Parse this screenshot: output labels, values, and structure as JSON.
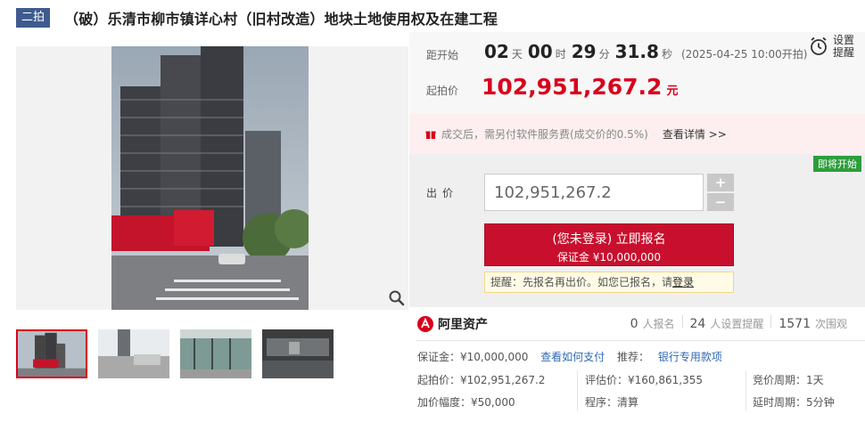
{
  "header": {
    "round_tag": "二拍",
    "title": "（破）乐清市柳市镇详心村（旧村改造）地块土地使用权及在建工程"
  },
  "countdown": {
    "label": "距开始",
    "days": "02",
    "days_unit": "天",
    "hours": "00",
    "hours_unit": "时",
    "minutes": "29",
    "minutes_unit": "分",
    "seconds": "31.8",
    "seconds_unit": "秒",
    "start_note": "(2025-04-25 10:00开拍)"
  },
  "remind": {
    "label": "设置提醒",
    "icon": "alarm-clock-icon"
  },
  "start_price": {
    "label": "起拍价",
    "value": "102,951,267.2",
    "unit": "元"
  },
  "fee_notice": {
    "text": "成交后，需另付软件服务费(成交价的0.5%)",
    "link": "查看详情 >>"
  },
  "bid": {
    "badge": "即将开始",
    "label": "出价",
    "input_value": "102,951,267.2",
    "plus": "+",
    "minus": "−",
    "signup_main": "(您未登录) 立即报名",
    "signup_sub": "保证金 ¥10,000,000",
    "tip_prefix": "提醒：先报名再出价。如您已报名，请",
    "tip_link": "登录"
  },
  "brand": {
    "name": "阿里资产"
  },
  "stats": [
    {
      "num": "0",
      "label": "人报名"
    },
    {
      "num": "24",
      "label": "人设置提醒"
    },
    {
      "num": "1571",
      "label": "次围观"
    }
  ],
  "deposit": {
    "label": "保证金：¥10,000,000",
    "pay_link": "查看如何支付",
    "recommend": "推荐：",
    "bank_link": "银行专用款项"
  },
  "details": {
    "start_price": "起拍价：¥102,951,267.2",
    "appraisal": "评估价：¥160,861,355",
    "period": "竞价周期：1天",
    "increment": "加价幅度：¥50,000",
    "procedure": "程序：清算",
    "delay": "延时周期：5分钟"
  },
  "colors": {
    "accent_red": "#d9001b",
    "button_red": "#c8102e",
    "link_blue": "#2f69b3",
    "badge_green": "#2e9d3b",
    "tag_blue": "#3f5b8e"
  }
}
